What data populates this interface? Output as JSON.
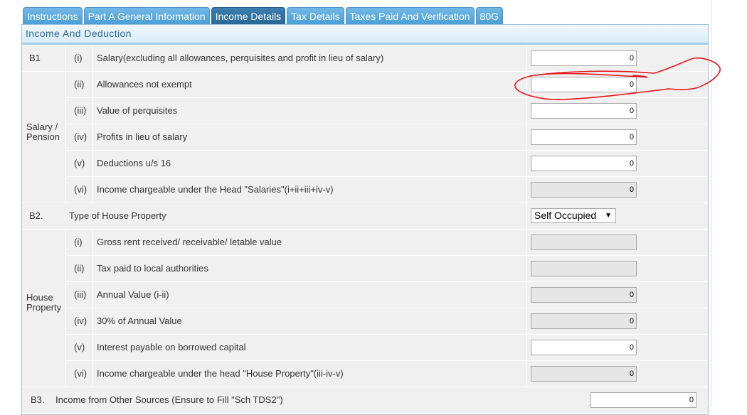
{
  "tabs": [
    {
      "label": "Instructions",
      "active": false
    },
    {
      "label": "Part A General Information",
      "active": false
    },
    {
      "label": "Income Details",
      "active": true
    },
    {
      "label": "Tax Details",
      "active": false
    },
    {
      "label": "Taxes Paid And Verification",
      "active": false
    },
    {
      "label": "80G",
      "active": false
    }
  ],
  "section": {
    "title": "Income And Deduction"
  },
  "b1": {
    "code": "B1"
  },
  "salary_group": {
    "line1": "Salary /",
    "line2": "Pension"
  },
  "salary_rows": [
    {
      "roman": "(i)",
      "desc": "Salary(excluding all allowances, perquisites and profit in lieu of salary)",
      "value": "0",
      "readonly": false
    },
    {
      "roman": "(ii)",
      "desc": "Allowances not exempt",
      "value": "0",
      "readonly": false
    },
    {
      "roman": "(iii)",
      "desc": "Value of perquisites",
      "value": "0",
      "readonly": false
    },
    {
      "roman": "(iv)",
      "desc": "Profits in lieu of salary",
      "value": "0",
      "readonly": false
    },
    {
      "roman": "(v)",
      "desc": "Deductions u/s 16",
      "value": "0",
      "readonly": false
    },
    {
      "roman": "(vi)",
      "desc": "Income chargeable under the Head \"Salaries\"(i+ii+iii+iv-v)",
      "value": "0",
      "readonly": true
    }
  ],
  "b2": {
    "code": "B2.",
    "desc": "Type of House Property",
    "selected": "Self Occupied"
  },
  "house_group": {
    "line1": "House",
    "line2": "Property"
  },
  "house_rows": [
    {
      "roman": "(i)",
      "desc": "Gross rent received/ receivable/ letable value",
      "value": "",
      "readonly": true
    },
    {
      "roman": "(ii)",
      "desc": "Tax paid to local authorities",
      "value": "",
      "readonly": true
    },
    {
      "roman": "(iii)",
      "desc": "Annual Value (i-ii)",
      "value": "0",
      "readonly": true
    },
    {
      "roman": "(iv)",
      "desc": "30% of Annual Value",
      "value": "0",
      "readonly": true
    },
    {
      "roman": "(v)",
      "desc": "Interest payable on borrowed capital",
      "value": "0",
      "readonly": false
    },
    {
      "roman": "(vi)",
      "desc": "Income chargeable under the head \"House Property\"(iii-iv-v)",
      "value": "0",
      "readonly": true
    }
  ],
  "b3": {
    "code": "B3.",
    "desc": "Income from Other Sources (Ensure to Fill \"Sch TDS2\")",
    "value": "0"
  },
  "annotation": {
    "color": "#e8141b"
  }
}
